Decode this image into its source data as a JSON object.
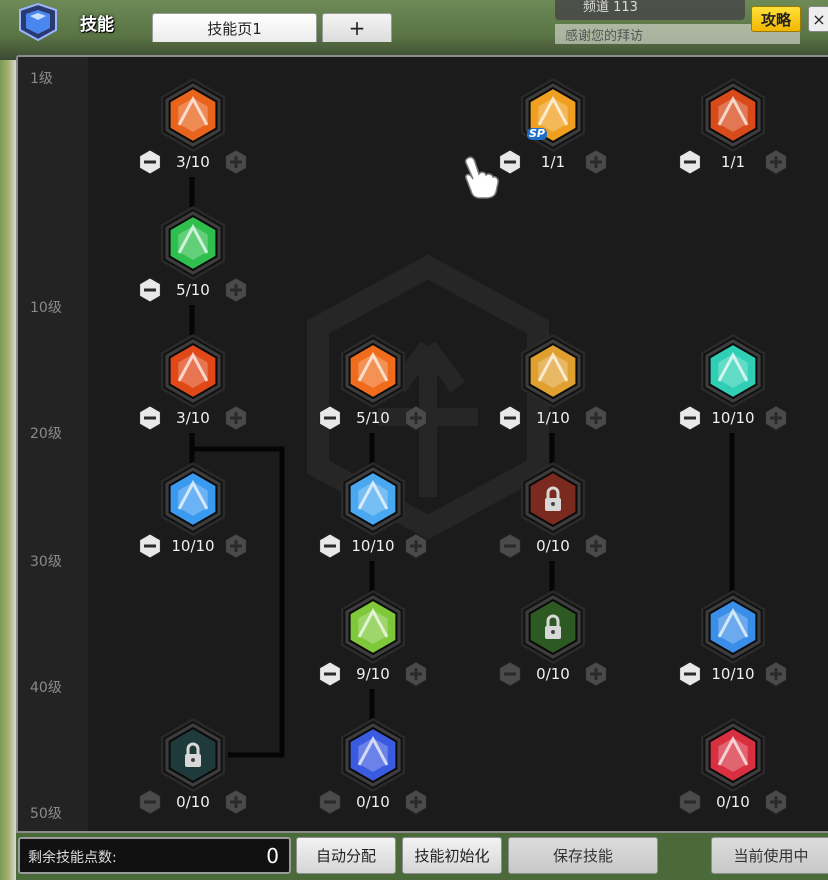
{
  "window": {
    "title": "技能",
    "channel": "频道 113",
    "greeting": "感谢您的拜访",
    "guide_label": "攻略",
    "close_label": "×"
  },
  "tabs": [
    {
      "label": "技能页1",
      "active": true
    },
    {
      "label": "+",
      "active": false
    }
  ],
  "levels": [
    "1级",
    "10级",
    "20级",
    "30级",
    "40级",
    "50级"
  ],
  "skills": [
    {
      "value": "3/10",
      "icon": "fire-slash-icon",
      "color": "#e8641c",
      "locked": false
    },
    {
      "value": "1/1",
      "icon": "crosshair-icon",
      "color": "#f0a020",
      "locked": false,
      "badge": "SP"
    },
    {
      "value": "1/1",
      "icon": "fire-fist-icon",
      "color": "#d84a1a",
      "locked": false
    },
    {
      "value": "5/10",
      "icon": "green-arrows-icon",
      "color": "#2fbf4f",
      "locked": false
    },
    {
      "value": "3/10",
      "icon": "fire-claw-icon",
      "color": "#e04818",
      "locked": false
    },
    {
      "value": "5/10",
      "icon": "fire-burst-icon",
      "color": "#f06c1c",
      "locked": false
    },
    {
      "value": "1/10",
      "icon": "eagle-icon",
      "color": "#e0a030",
      "locked": false
    },
    {
      "value": "10/10",
      "icon": "spirit-body-icon",
      "color": "#2ecfb4",
      "locked": false
    },
    {
      "value": "10/10",
      "icon": "ice-cage-icon",
      "color": "#3a9af0",
      "locked": false
    },
    {
      "value": "10/10",
      "icon": "ice-arrow-icon",
      "color": "#4aa8f0",
      "locked": false
    },
    {
      "value": "0/10",
      "icon": "lock-icon",
      "color": "#7a2a1e",
      "locked": true
    },
    {
      "value": "9/10",
      "icon": "wind-bow-icon",
      "color": "#7ec83a",
      "locked": false
    },
    {
      "value": "0/10",
      "icon": "lock-icon",
      "color": "#2c5a22",
      "locked": true
    },
    {
      "value": "10/10",
      "icon": "sun-gear-icon",
      "color": "#3a8ee8",
      "locked": false
    },
    {
      "value": "0/10",
      "icon": "lock-icon",
      "color": "#1e3a3a",
      "locked": true
    },
    {
      "value": "0/10",
      "icon": "lightning-icon",
      "color": "#3a5ae0",
      "locked": false
    },
    {
      "value": "0/10",
      "icon": "red-crystal-icon",
      "color": "#d83040",
      "locked": false
    }
  ],
  "bottom": {
    "points_label": "剩余技能点数:",
    "points_value": "0",
    "auto_label": "自动分配",
    "reset_label": "技能初始化",
    "save_label": "保存技能",
    "current_label": "当前使用中"
  },
  "colors": {
    "panel_bg": "#1b1b1b",
    "hex_border": "#3a3a3a",
    "accent": "#f2b600"
  }
}
